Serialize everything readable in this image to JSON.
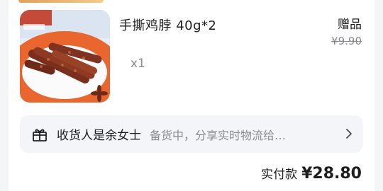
{
  "product": {
    "title": "手撕鸡脖 40g*2",
    "quantity": "x1",
    "tag": "赠品",
    "original_price": "¥9.90"
  },
  "receiver": {
    "label": "收货人是余女士",
    "hint": "备货中，分享实时物流给…"
  },
  "summary": {
    "label": "实付款",
    "amount": "¥28.80"
  },
  "colors": {
    "plate_orange": "#e9672f",
    "text_primary": "#1d1d1f",
    "text_secondary": "#8a8a8f"
  },
  "icons": [
    "gift-box-icon",
    "chevron-right-icon"
  ]
}
